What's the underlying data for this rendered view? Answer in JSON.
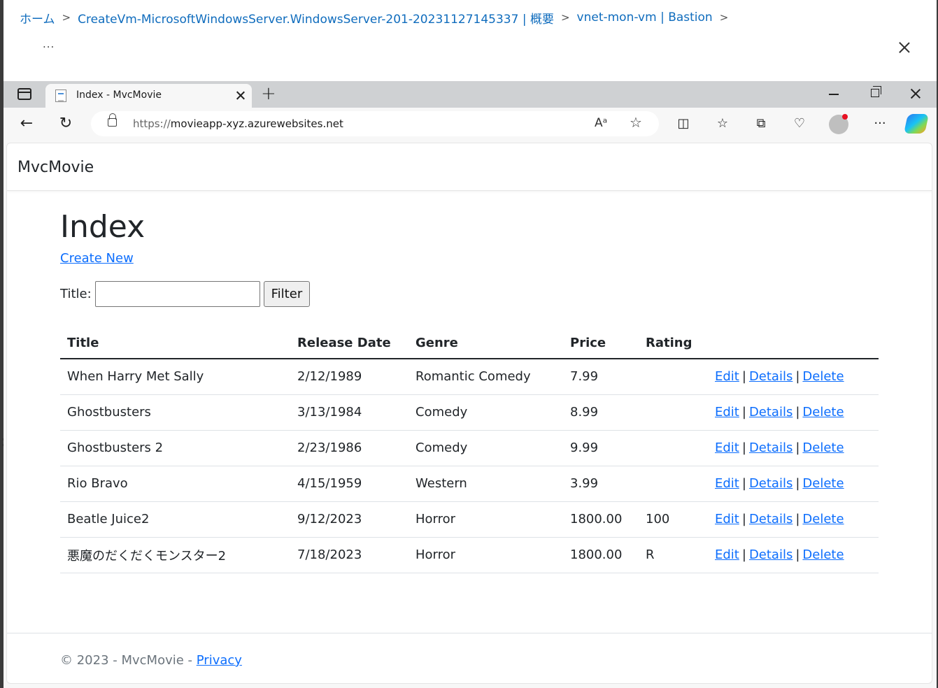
{
  "portal": {
    "breadcrumb": [
      {
        "label": "ホーム"
      },
      {
        "label": "CreateVm-MicrosoftWindowsServer.WindowsServer-201-20231127145337 | 概要"
      },
      {
        "label": "vnet-mon-vm | Bastion"
      }
    ],
    "ellipsis": "...",
    "expand_glyph": "»"
  },
  "browser": {
    "tab_title": "Index - MvcMovie",
    "url_scheme": "https://",
    "url_host": "movieapp-xyz.azurewebsites.net",
    "read_aloud": "Aᵃ",
    "icons": [
      "sidebar-icon",
      "back-icon",
      "refresh-icon",
      "lock-icon",
      "read-aloud-icon",
      "favorite-star-icon",
      "split-screen-icon",
      "favorites-icon",
      "collections-icon",
      "browser-essentials-icon",
      "profile-icon",
      "more-icon",
      "copilot-icon"
    ]
  },
  "site": {
    "brand": "MvcMovie",
    "heading": "Index",
    "create_new": "Create New",
    "filter_label": "Title:",
    "filter_value": "",
    "filter_button": "Filter",
    "columns": [
      "Title",
      "Release Date",
      "Genre",
      "Price",
      "Rating",
      ""
    ],
    "action_labels": {
      "edit": "Edit",
      "details": "Details",
      "delete": "Delete",
      "separator": "|"
    },
    "movies": [
      {
        "title": "When Harry Met Sally",
        "release_date": "2/12/1989",
        "genre": "Romantic Comedy",
        "price": "7.99",
        "rating": ""
      },
      {
        "title": "Ghostbusters",
        "release_date": "3/13/1984",
        "genre": "Comedy",
        "price": "8.99",
        "rating": ""
      },
      {
        "title": "Ghostbusters 2",
        "release_date": "2/23/1986",
        "genre": "Comedy",
        "price": "9.99",
        "rating": ""
      },
      {
        "title": "Rio Bravo",
        "release_date": "4/15/1959",
        "genre": "Western",
        "price": "3.99",
        "rating": ""
      },
      {
        "title": "Beatle Juice2",
        "release_date": "9/12/2023",
        "genre": "Horror",
        "price": "1800.00",
        "rating": "100"
      },
      {
        "title": "悪魔のだくだくモンスター2",
        "release_date": "7/18/2023",
        "genre": "Horror",
        "price": "1800.00",
        "rating": "R"
      }
    ],
    "footer_text": "© 2023 - MvcMovie - ",
    "footer_link": "Privacy"
  },
  "colors": {
    "portal_link": "#0f6cbd",
    "site_link": "#0d6efd",
    "text": "#212529",
    "muted": "#6c757d"
  }
}
